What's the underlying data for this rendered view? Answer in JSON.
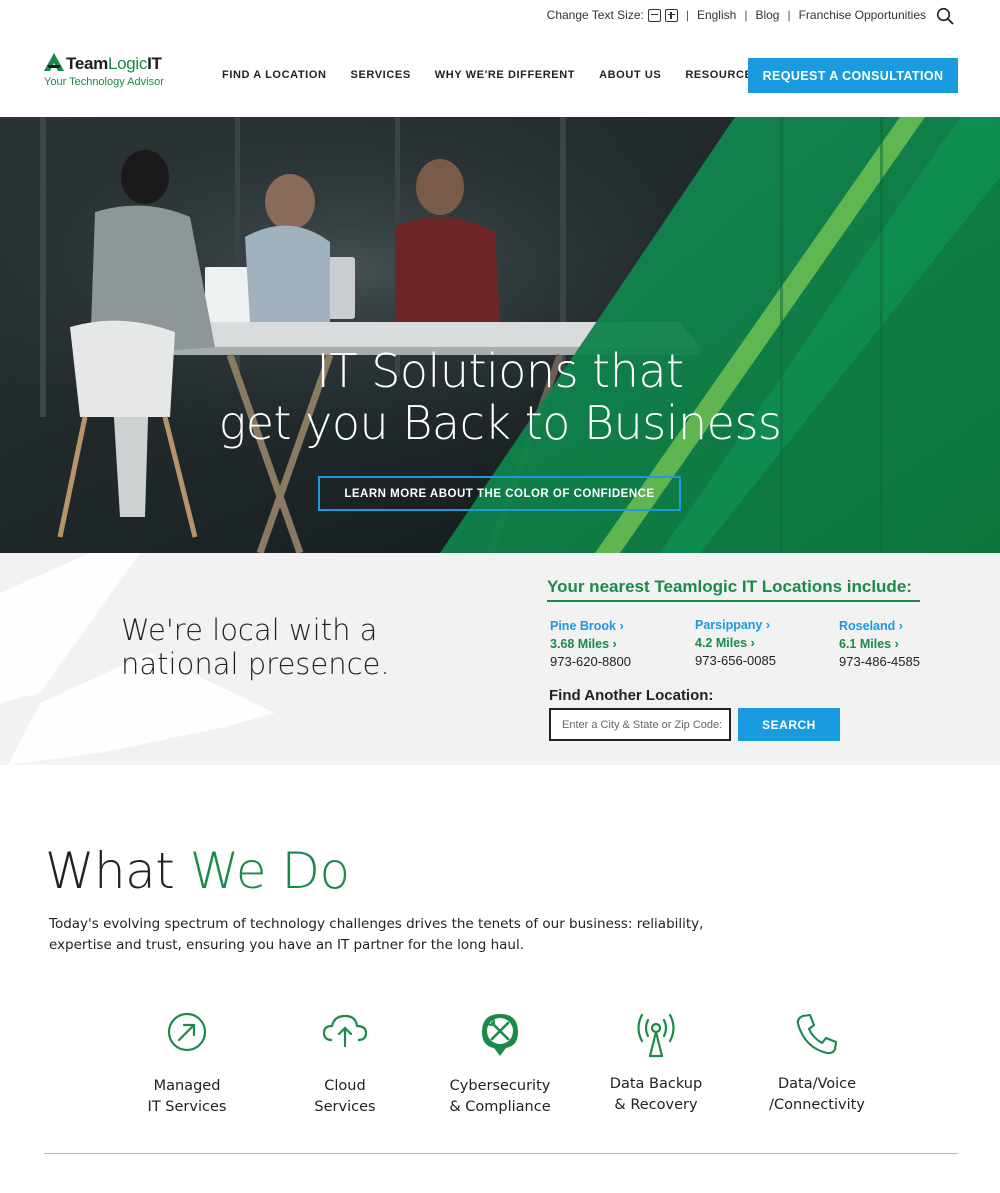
{
  "utility": {
    "text_size_label": "Change Text Size:",
    "language": "English",
    "blog": "Blog",
    "franchise": "Franchise Opportunities"
  },
  "logo": {
    "name_part1": "Team",
    "name_part2": "Logic",
    "name_part3": "IT",
    "tagline": "Your Technology Advisor"
  },
  "nav": {
    "items": [
      {
        "label": "FIND A LOCATION"
      },
      {
        "label": "SERVICES"
      },
      {
        "label": "WHY WE'RE DIFFERENT"
      },
      {
        "label": "ABOUT US"
      },
      {
        "label": "RESOURCES"
      }
    ],
    "cta": "REQUEST A CONSULTATION"
  },
  "hero": {
    "title_line1": "IT Solutions that",
    "title_line2": "get you Back to Business",
    "button": "LEARN MORE ABOUT THE COLOR OF CONFIDENCE"
  },
  "local": {
    "title_line1": "We're local with a",
    "title_line2": "national presence.",
    "nearest_title": "Your nearest Teamlogic IT Locations include:",
    "locations": [
      {
        "city": "Pine Brook",
        "miles": "3.68 Miles",
        "phone": "973-620-8800"
      },
      {
        "city": "Parsippany",
        "miles": "4.2 Miles",
        "phone": "973-656-0085"
      },
      {
        "city": "Roseland",
        "miles": "6.1 Miles",
        "phone": "973-486-4585"
      }
    ],
    "find_label": "Find Another Location:",
    "find_placeholder": "Enter a City & State or Zip Code:",
    "search_button": "SEARCH"
  },
  "what_we_do": {
    "title_part1": "What",
    "title_part2": "We Do",
    "description": "Today's evolving spectrum of technology challenges drives the tenets of our business: reliability, expertise and trust, ensuring you have an IT partner for the long haul.",
    "services": [
      {
        "line1": "Managed",
        "line2": "IT Services",
        "icon": "arrow-up-right-circle-icon"
      },
      {
        "line1": "Cloud",
        "line2": "Services",
        "icon": "cloud-upload-icon"
      },
      {
        "line1": "Cybersecurity",
        "line2": "& Compliance",
        "icon": "tools-badge-icon"
      },
      {
        "line1": "Data Backup",
        "line2": "& Recovery",
        "icon": "broadcast-tower-icon"
      },
      {
        "line1": "Data/Voice",
        "line2": "/Connectivity",
        "icon": "phone-icon"
      }
    ]
  },
  "colors": {
    "brand_green": "#1a8a4a",
    "accent_blue": "#1a9be0"
  }
}
